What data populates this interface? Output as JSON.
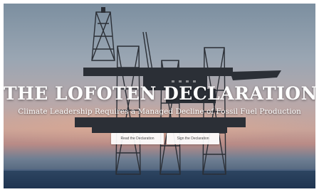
{
  "hero": {
    "title": "THE LOFOTEN DECLARATION",
    "subtitle": "Climate Leadership Requires a Managed Decline of Fossil Fuel Production",
    "background_image": "offshore-oil-rig-at-dusk"
  },
  "actions": {
    "read_label": "Read the Declaration",
    "sign_label": "Sign the Declaration"
  },
  "colors": {
    "text": "#ffffff",
    "button_bg": "#f2f2f2",
    "button_text": "#4a4a4a",
    "sea": "#1f3450"
  }
}
